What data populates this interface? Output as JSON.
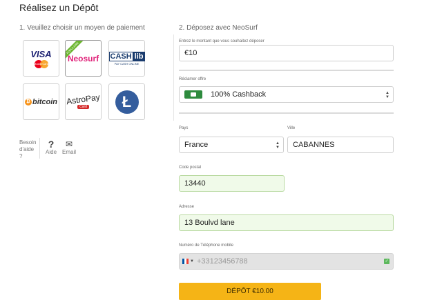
{
  "page": {
    "title": "Réalisez un Dépôt"
  },
  "steps": {
    "left": "1. Veuillez choisir un moyen de paiement",
    "right": "2. Déposez avec NeoSurf"
  },
  "payment_methods": [
    {
      "name": "VISA",
      "sub": "MasterCard"
    },
    {
      "name": "Neosurf",
      "ribbon": "POPULAIRE"
    },
    {
      "name": "CASH",
      "suffix": "lib",
      "sub": "PAY CASH ONLINE"
    },
    {
      "name": "bitcoin"
    },
    {
      "name": "AstroPay",
      "sub": "Card"
    },
    {
      "name": "litecoin-icon"
    }
  ],
  "help": {
    "besoin": "Besoin d'aide ?",
    "aide": "Aide",
    "email": "Email"
  },
  "form": {
    "amount_label": "Entrez le montant que vous souhaitez déposer",
    "amount_value": "€10",
    "offer_label": "Réclamer offre",
    "offer_value": "100% Cashback",
    "country_label": "Pays",
    "country_value": "France",
    "city_label": "Ville",
    "city_value": "CABANNES",
    "postal_label": "Code postal",
    "postal_value": "13440",
    "address_label": "Adresse",
    "address_value": "13 Boulvd lane",
    "phone_label": "Numéro de Téléphone mobile",
    "phone_placeholder": "+33123456788"
  },
  "deposit_button": "DÉPÔT €10.00",
  "colors": {
    "accent": "#f5b416",
    "valid_bg": "#f0fae9",
    "valid_border": "#b8d9a0",
    "neosurf_pink": "#e0237a",
    "cashlib_blue": "#1a3c6e",
    "bitcoin_orange": "#f7931a",
    "litecoin_blue": "#345d9d"
  }
}
